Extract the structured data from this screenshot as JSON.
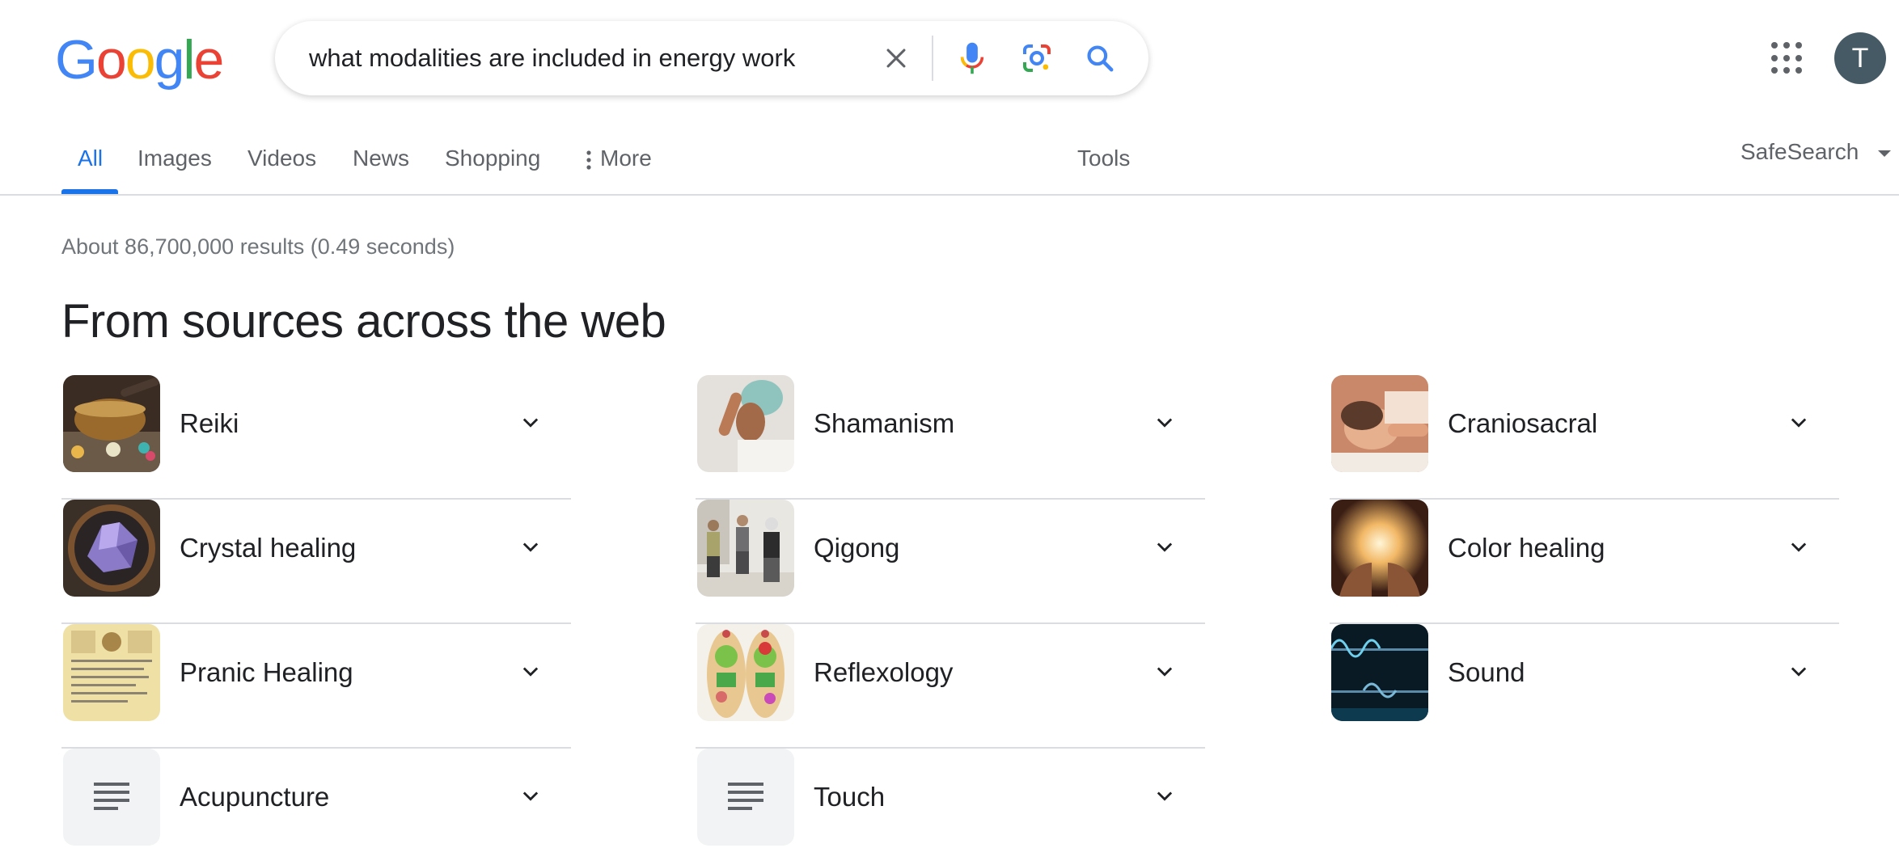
{
  "logo": {
    "letters": [
      "G",
      "o",
      "o",
      "g",
      "l",
      "e"
    ],
    "colors": [
      "#4285F4",
      "#EA4335",
      "#FBBC05",
      "#4285F4",
      "#34A853",
      "#EA4335"
    ]
  },
  "search": {
    "query": "what modalities are included in energy work",
    "icons": [
      "clear-icon",
      "mic-icon",
      "lens-icon",
      "search-icon"
    ]
  },
  "header": {
    "apps_icon": "apps-grid-icon",
    "avatar_letter": "T"
  },
  "tabs": {
    "items": [
      "All",
      "Images",
      "Videos",
      "News",
      "Shopping"
    ],
    "more": "More",
    "tools": "Tools",
    "safesearch": "SafeSearch"
  },
  "results": {
    "stats": "About 86,700,000 results (0.49 seconds)",
    "heading": "From sources across the web"
  },
  "modalities": {
    "col1": [
      "Reiki",
      "Crystal healing",
      "Pranic Healing",
      "Acupuncture"
    ],
    "col2": [
      "Shamanism",
      "Qigong",
      "Reflexology",
      "Touch"
    ],
    "col3": [
      "Craniosacral",
      "Color healing",
      "Sound"
    ]
  },
  "colors": {
    "accent": "#1a73e8",
    "text": "#202124",
    "muted": "#5f6368",
    "divider": "#dadce0"
  }
}
